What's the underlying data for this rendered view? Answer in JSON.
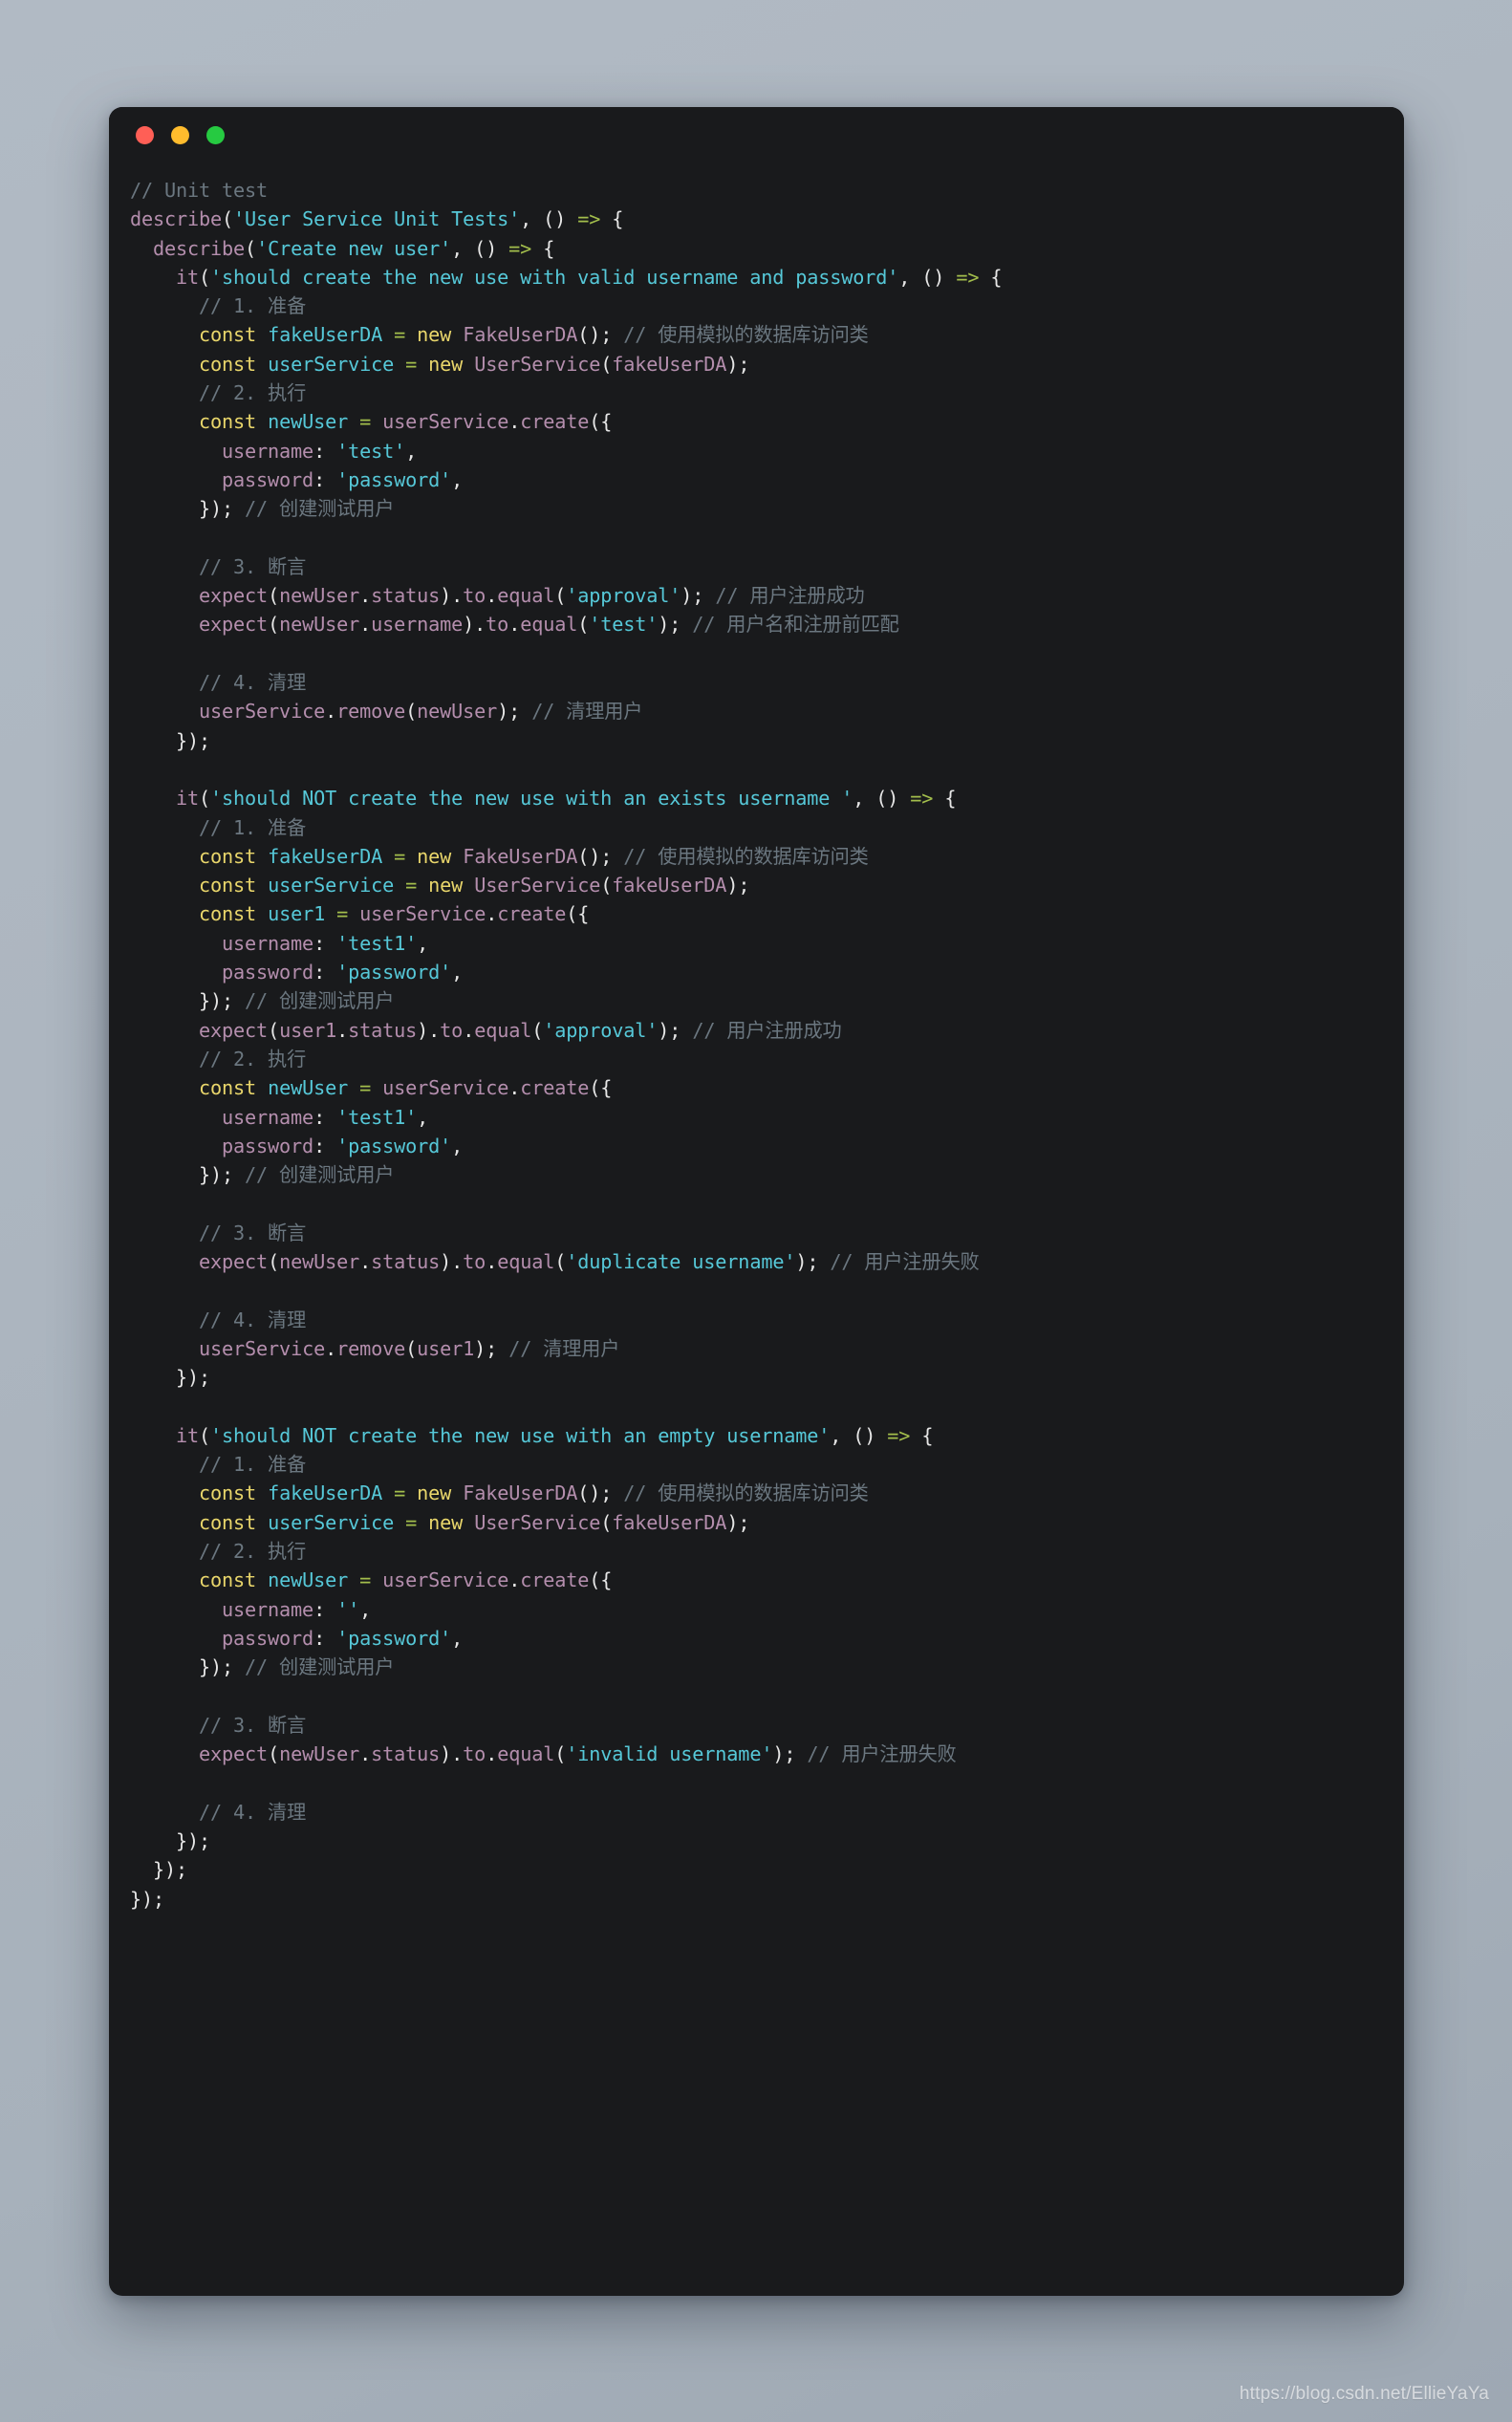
{
  "window": {
    "traffic_lights": [
      {
        "name": "close",
        "color": "#ff5f56"
      },
      {
        "name": "minimize",
        "color": "#ffbc2d"
      },
      {
        "name": "zoom",
        "color": "#26ca41"
      }
    ],
    "background_color": "#191a1c"
  },
  "watermark": {
    "text": "https://blog.csdn.net/EllieYaYa"
  },
  "theme": {
    "comment": "#6b7780",
    "keyword": "#e9d66b",
    "variable": "#56c8d8",
    "function": "#b48ead",
    "string": "#56c8d8",
    "operator": "#a3be4c",
    "punctuation": "#e6e6e6"
  },
  "code": {
    "language": "javascript",
    "lines": [
      "// Unit test",
      "describe('User Service Unit Tests', () => {",
      "  describe('Create new user', () => {",
      "    it('should create the new use with valid username and password', () => {",
      "      // 1. 准备",
      "      const fakeUserDA = new FakeUserDA(); // 使用模拟的数据库访问类",
      "      const userService = new UserService(fakeUserDA);",
      "      // 2. 执行",
      "      const newUser = userService.create({",
      "        username: 'test',",
      "        password: 'password',",
      "      }); // 创建测试用户",
      "",
      "      // 3. 断言",
      "      expect(newUser.status).to.equal('approval'); // 用户注册成功",
      "      expect(newUser.username).to.equal('test'); // 用户名和注册前匹配",
      "",
      "      // 4. 清理",
      "      userService.remove(newUser); // 清理用户",
      "    });",
      "",
      "    it('should NOT create the new use with an exists username ', () => {",
      "      // 1. 准备",
      "      const fakeUserDA = new FakeUserDA(); // 使用模拟的数据库访问类",
      "      const userService = new UserService(fakeUserDA);",
      "      const user1 = userService.create({",
      "        username: 'test1',",
      "        password: 'password',",
      "      }); // 创建测试用户",
      "      expect(user1.status).to.equal('approval'); // 用户注册成功",
      "      // 2. 执行",
      "      const newUser = userService.create({",
      "        username: 'test1',",
      "        password: 'password',",
      "      }); // 创建测试用户",
      "",
      "      // 3. 断言",
      "      expect(newUser.status).to.equal('duplicate username'); // 用户注册失败",
      "",
      "      // 4. 清理",
      "      userService.remove(user1); // 清理用户",
      "    });",
      "",
      "    it('should NOT create the new use with an empty username', () => {",
      "      // 1. 准备",
      "      const fakeUserDA = new FakeUserDA(); // 使用模拟的数据库访问类",
      "      const userService = new UserService(fakeUserDA);",
      "      // 2. 执行",
      "      const newUser = userService.create({",
      "        username: '',",
      "        password: 'password',",
      "      }); // 创建测试用户",
      "",
      "      // 3. 断言",
      "      expect(newUser.status).to.equal('invalid username'); // 用户注册失败",
      "",
      "      // 4. 清理",
      "    });",
      "  });",
      "});"
    ]
  }
}
